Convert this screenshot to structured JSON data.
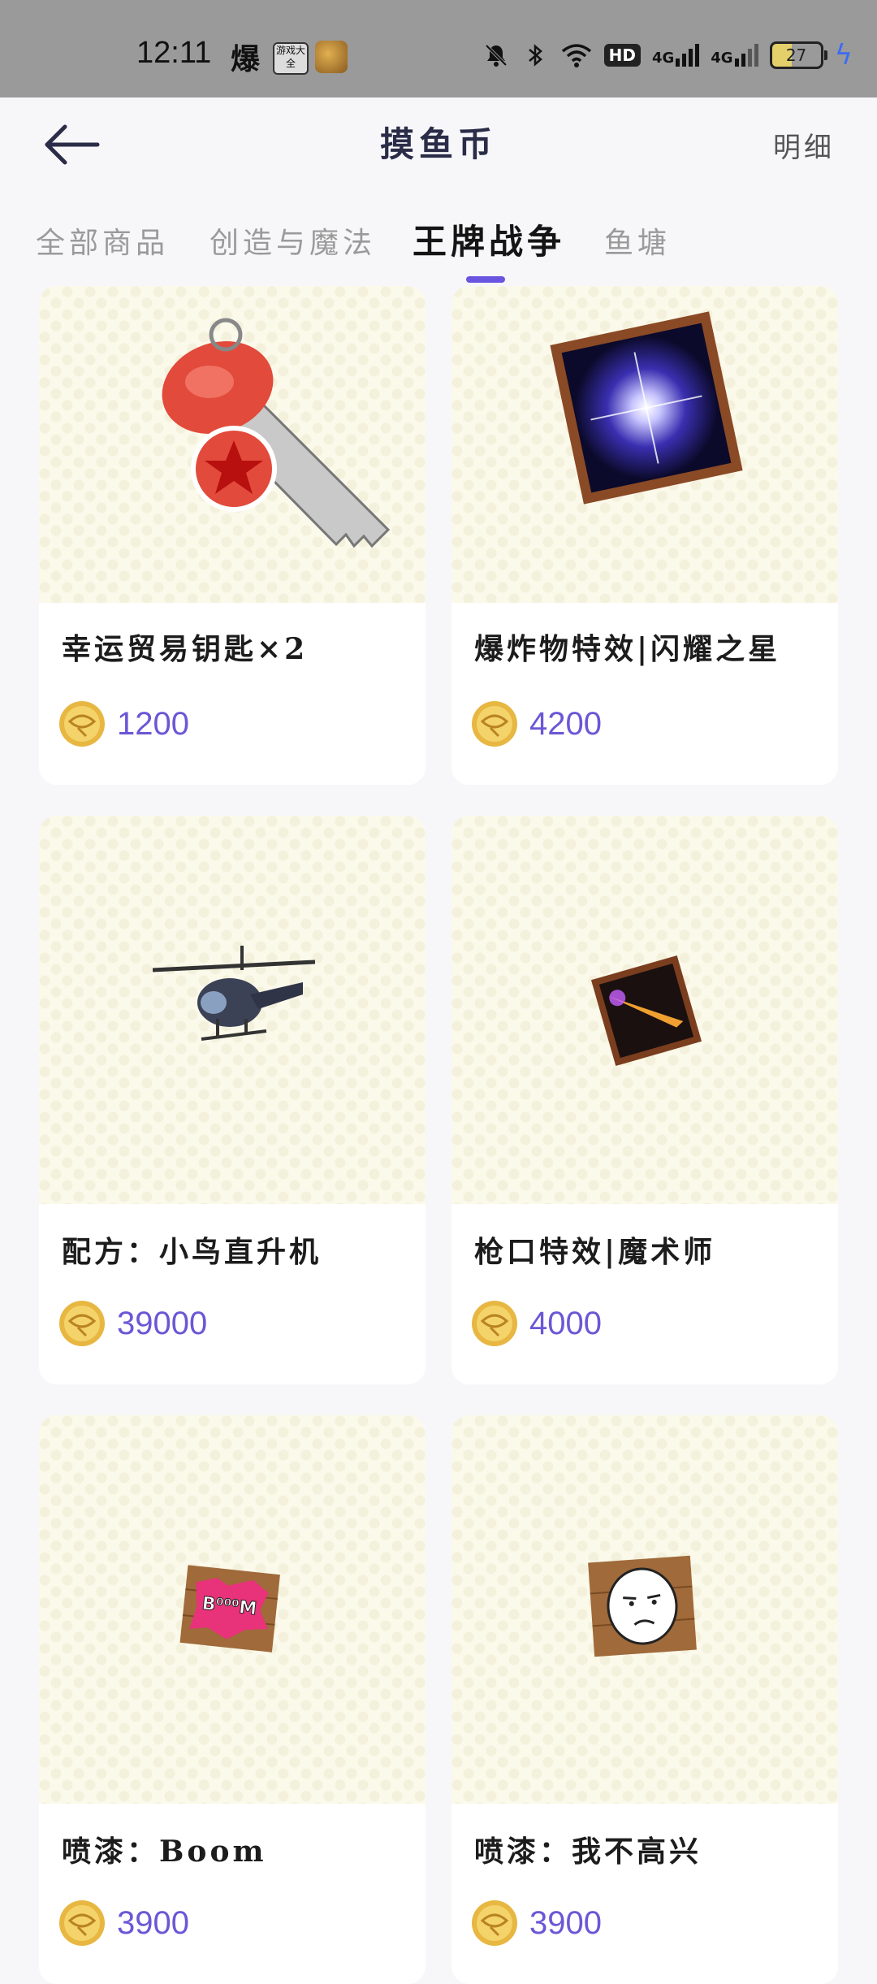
{
  "status_bar": {
    "time": "12:11",
    "app_text": "爆",
    "app_icon_label": "游戏大全",
    "hd_badge": "HD",
    "signal1": "4G",
    "signal2": "4G",
    "battery_level": "27"
  },
  "header": {
    "title": "摸鱼币",
    "detail_link": "明细"
  },
  "tabs": [
    {
      "label": "全部商品",
      "active": false
    },
    {
      "label": "创造与魔法",
      "active": false
    },
    {
      "label": "王牌战争",
      "active": true
    },
    {
      "label": "鱼塘",
      "active": false
    }
  ],
  "colors": {
    "accent": "#6a55e0",
    "price": "#6b57d6",
    "card_bg": "#ffffff",
    "thumb_bg": "#fbf9ea"
  },
  "items": [
    {
      "name": "幸运贸易钥匙×2",
      "price": "1200",
      "icon": "key-icon"
    },
    {
      "name": "爆炸物特效|闪耀之星",
      "price": "4200",
      "icon": "shining-star-effect-icon"
    },
    {
      "name": "配方：小鸟直升机",
      "price": "39000",
      "icon": "helicopter-icon"
    },
    {
      "name": "枪口特效|魔术师",
      "price": "4000",
      "icon": "muzzle-effect-icon"
    },
    {
      "name": "喷漆：Boom",
      "price": "3900",
      "icon": "boom-spray-icon"
    },
    {
      "name": "喷漆：我不高兴",
      "price": "3900",
      "icon": "unhappy-spray-icon"
    }
  ]
}
